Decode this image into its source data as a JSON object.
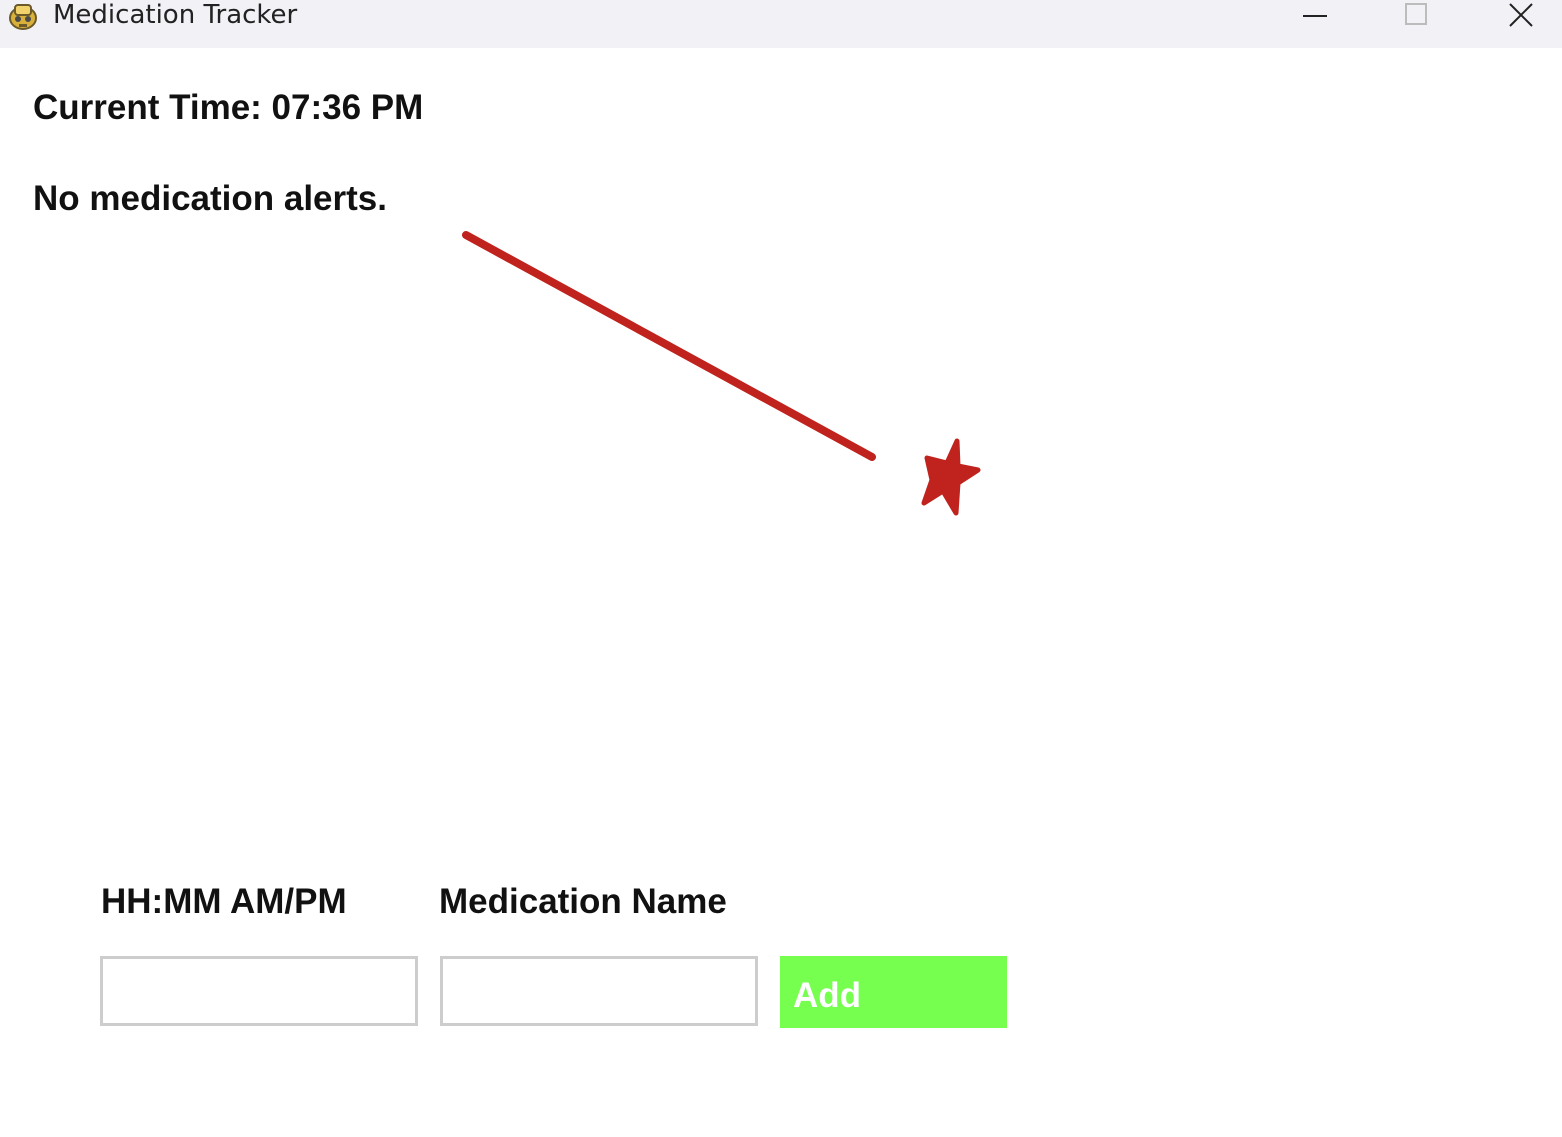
{
  "window": {
    "title": "Medication Tracker",
    "icon": "app-icon",
    "controls": [
      "minimize-icon",
      "maximize-icon",
      "close-icon"
    ]
  },
  "main": {
    "current_time": "Current Time: 07:36 PM",
    "alerts": "No medication alerts."
  },
  "form": {
    "time_label": "HH:MM AM/PM",
    "medication_label": "Medication Name",
    "time_value": "",
    "medication_value": "",
    "add_label": "Add"
  },
  "colors": {
    "titlebar": "#f1f1f6",
    "add_button": "#77ff4f",
    "annotation": "#c0231d",
    "input_border": "#cdcdcd"
  }
}
